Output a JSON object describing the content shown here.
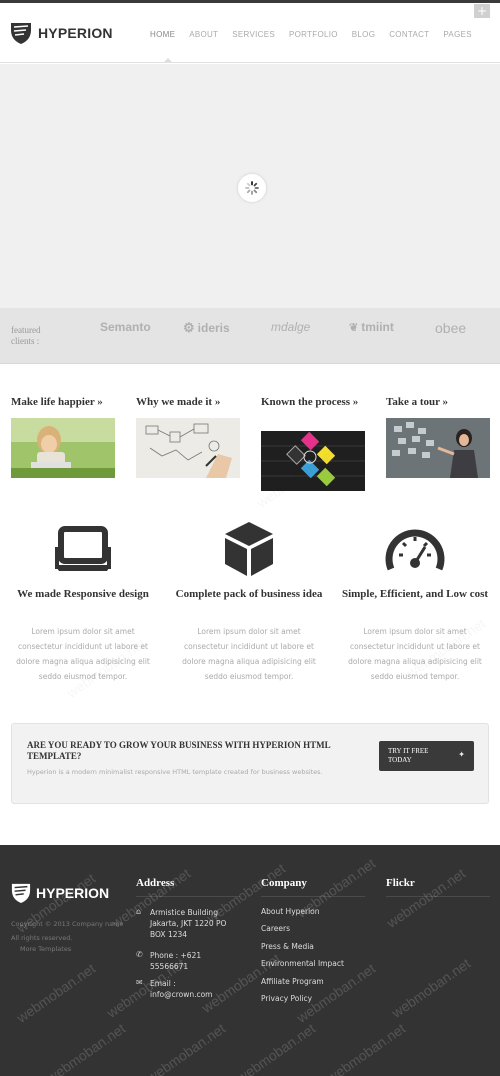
{
  "header": {
    "logo_text": "HYPERION",
    "nav": [
      "HOME",
      "ABOUT",
      "SERVICES",
      "PORTFOLIO",
      "BLOG",
      "CONTACT",
      "PAGES"
    ],
    "plus_label": "+"
  },
  "clients": {
    "label": "featured clients :",
    "logos": [
      "Semanto",
      "ideris",
      "mdalge",
      "tmiint",
      "obee"
    ]
  },
  "features": [
    {
      "title": "Make life happier »"
    },
    {
      "title": "Why we made it »"
    },
    {
      "title": "Known the process »"
    },
    {
      "title": "Take a tour »"
    }
  ],
  "services": [
    {
      "icon": "laptop-icon",
      "title": "We made Responsive design",
      "text": "Lorem ipsum dolor sit amet consectetur incididunt ut labore et dolore magna aliqua adipisicing elit seddo eiusmod tempor."
    },
    {
      "icon": "cube-icon",
      "title": "Complete pack of business idea",
      "text": "Lorem ipsum dolor sit amet consectetur incididunt ut labore et dolore magna aliqua adipisicing elit seddo eiusmod tempor."
    },
    {
      "icon": "gauge-icon",
      "title": "Simple, Efficient, and Low cost",
      "text": "Lorem ipsum dolor sit amet consectetur incididunt ut labore et dolore magna aliqua adipisicing elit seddo eiusmod tempor."
    }
  ],
  "cta": {
    "title": "ARE YOU READY TO GROW YOUR BUSINESS WITH HYPERION HTML TEMPLATE?",
    "text": "Hyperion is a modern minimalist responsive HTML template created for business websites.",
    "button": "TRY IT FREE TODAY"
  },
  "footer": {
    "logo_text": "HYPERION",
    "copyright": "Copyright © 2013 Company name All rights reserved.",
    "more": "More Templates",
    "address_heading": "Address",
    "address": "Armistice Building Jakarta, JKT 1220 PO BOX 1234",
    "phone": "Phone : +621 55566671",
    "email": "Email : info@crown.com",
    "company_heading": "Company",
    "company_links": [
      "About Hyperion",
      "Careers",
      "Press & Media",
      "Environmental Impact",
      "Affiliate Program",
      "Privacy Policy"
    ],
    "flickr_heading": "Flickr"
  },
  "watermark": "webmoban.net",
  "colors": {
    "footer_bg": "#333333",
    "cta_button": "#3a3a3a",
    "slider_bg": "#f0f0f0"
  }
}
